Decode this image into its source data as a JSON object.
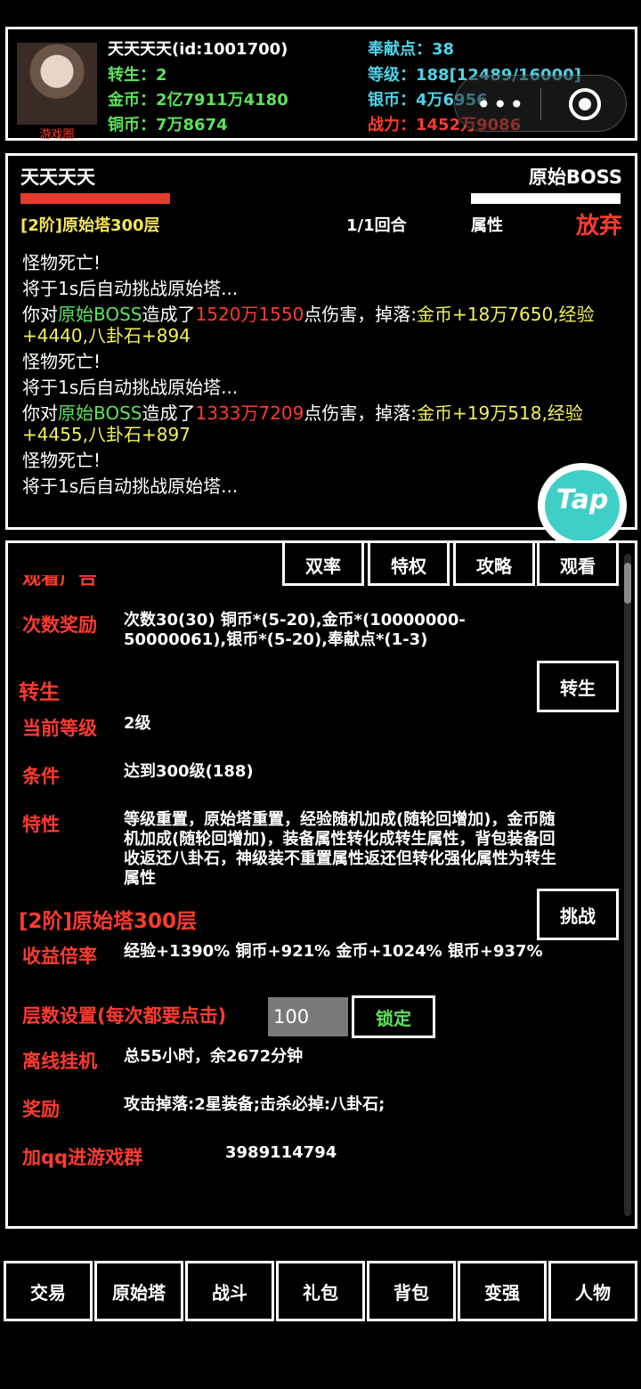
{
  "header": {
    "avatar_tag": "游戏圈",
    "name_id": "天天天天(id:1001700)",
    "rebirth": "转生：2",
    "gold": "金币：2亿7911万4180",
    "copper": "铜币：7万8674",
    "contribution": "奉献点：38",
    "level": "等级：188[12489/16000]",
    "silver": "银币：4万6956",
    "power": "战力：1452万9086"
  },
  "capsule": {
    "dots": "•••"
  },
  "battle": {
    "player_name": "天天天天",
    "boss_name": "原始BOSS",
    "stage": "[2阶]原始塔300层",
    "round": "1/1回合",
    "attr_label": "属性",
    "give_up": "放弃",
    "log": {
      "l1": "怪物死亡!",
      "l2": "将于1s后自动挑战原始塔...",
      "l3a": "你对",
      "l3b": "原始BOSS",
      "l3c": "造成了",
      "l3d": "1520万1550",
      "l3e": "点伤害，掉落:",
      "l3f": "金币+18万7650,经验+4440,八卦石+894",
      "l4": "怪物死亡!",
      "l5": "将于1s后自动挑战原始塔...",
      "l6a": "你对",
      "l6b": "原始BOSS",
      "l6c": "造成了",
      "l6d": "1333万7209",
      "l6e": "点伤害，掉落:",
      "l6f": "金币+19万518,经验+4455,八卦石+897",
      "l7": "怪物死亡!",
      "l8": "将于1s后自动挑战原始塔..."
    }
  },
  "tap_badge": "Tap",
  "info": {
    "cut_label": "观看广告",
    "top_buttons": [
      "双率",
      "特权",
      "攻略",
      "观看"
    ],
    "reward_count_label": "次数奖励",
    "reward_count_value": "次数30(30) 铜币*(5-20),金币*(10000000-50000061),银币*(5-20),奉献点*(1-3)",
    "rebirth_title": "转生",
    "rebirth_button": "转生",
    "cur_level_label": "当前等级",
    "cur_level_value": "2级",
    "condition_label": "条件",
    "condition_value": "达到300级(188)",
    "feature_label": "特性",
    "feature_value": "等级重置，原始塔重置，经验随机加成(随轮回增加)，金币随机加成(随轮回增加)，装备属性转化成转生属性，背包装备回收返还八卦石，神级装不重置属性返还但转化强化属性为转生属性",
    "tower_title": "[2阶]原始塔300层",
    "challenge_button": "挑战",
    "income_label": "收益倍率",
    "income_value": "经验+1390% 铜币+921% 金币+1024% 银币+937%",
    "floor_label": "层数设置(每次都要点击)",
    "floor_input": "100",
    "lock_button": "锁定",
    "offline_label": "离线挂机",
    "offline_value": "总55小时，余2672分钟",
    "reward_label": "奖励",
    "reward_value": "攻击掉落:2星装备;击杀必掉:八卦石;",
    "qq_label": "加qq进游戏群",
    "qq_value": "3989114794"
  },
  "tabs": [
    "交易",
    "原始塔",
    "战斗",
    "礼包",
    "背包",
    "变强",
    "人物"
  ]
}
